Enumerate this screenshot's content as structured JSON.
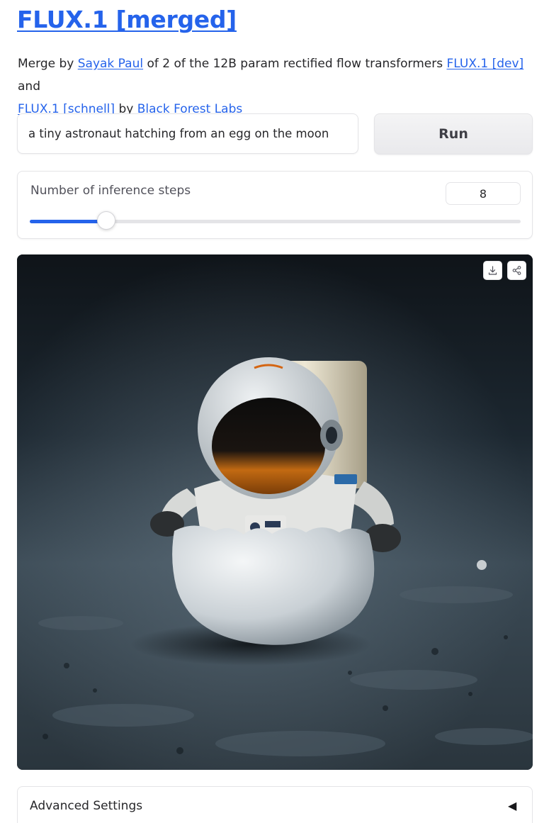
{
  "header": {
    "title": "FLUX.1 [merged]"
  },
  "description": {
    "text_1": "Merge by ",
    "author_link": "Sayak Paul",
    "text_2": " of 2 of the 12B param rectified flow transformers ",
    "dev_link": "FLUX.1 [dev]",
    "text_3": " and ",
    "schnell_link": "FLUX.1 [schnell]",
    "text_4": " by ",
    "org_link": "Black Forest Labs"
  },
  "prompt": {
    "value": "a tiny astronaut hatching from an egg on the moon"
  },
  "run_button": {
    "label": "Run"
  },
  "steps": {
    "label": "Number of inference steps",
    "value": "8",
    "slider_fraction": 0.156
  },
  "output_image": {
    "icons": [
      "download-icon",
      "share-icon"
    ]
  },
  "advanced": {
    "label": "Advanced Settings",
    "arrow": "◀"
  },
  "colors": {
    "accent": "#2563eb",
    "border": "#e4e4e7",
    "button_bg": "#f4f4f5"
  }
}
